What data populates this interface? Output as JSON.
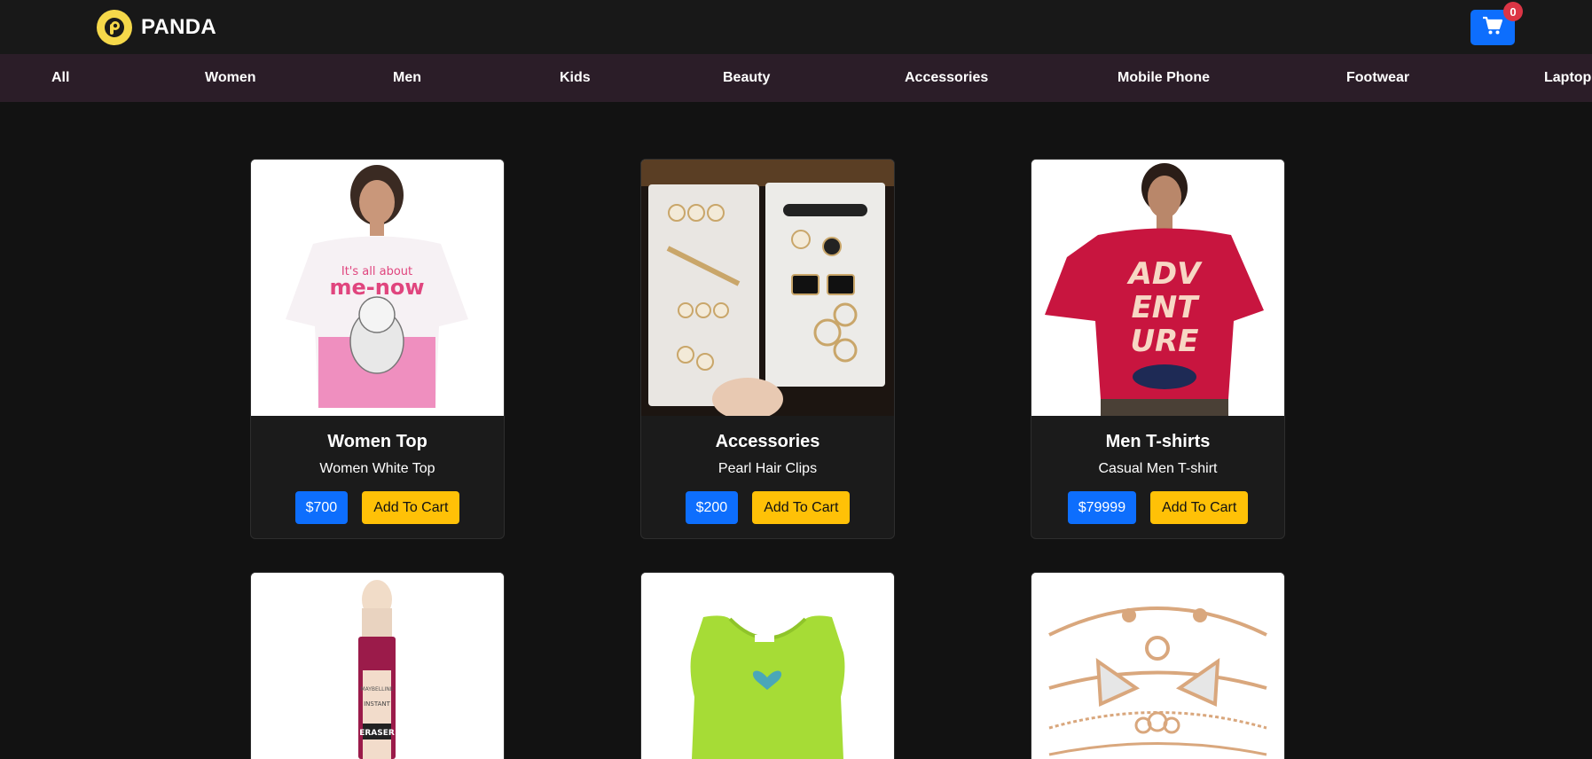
{
  "header": {
    "brand": "PANDA",
    "cart_count": "0",
    "colors": {
      "brand_yellow": "#f5d84a",
      "primary": "#0d6efd",
      "badge": "#dc3545"
    },
    "icons": {
      "logo": "panda-logo-icon",
      "cart": "shopping-cart-icon"
    }
  },
  "categories": [
    {
      "label": "All"
    },
    {
      "label": "Women"
    },
    {
      "label": "Men"
    },
    {
      "label": "Kids"
    },
    {
      "label": "Beauty"
    },
    {
      "label": "Accessories"
    },
    {
      "label": "Mobile Phone"
    },
    {
      "label": "Footwear"
    },
    {
      "label": "Laptop"
    }
  ],
  "products": [
    {
      "title": "Women Top",
      "desc": "Women White Top",
      "price": "$700",
      "button": "Add To Cart"
    },
    {
      "title": "Accessories",
      "desc": "Pearl Hair Clips",
      "price": "$200",
      "button": "Add To Cart"
    },
    {
      "title": "Men T-shirts",
      "desc": "Casual Men T-shirt",
      "price": "$79999",
      "button": "Add To Cart"
    }
  ],
  "colors": {
    "accent_yellow": "#ffc107",
    "nav_bg": "#2b1d28",
    "page_bg": "#121212"
  }
}
